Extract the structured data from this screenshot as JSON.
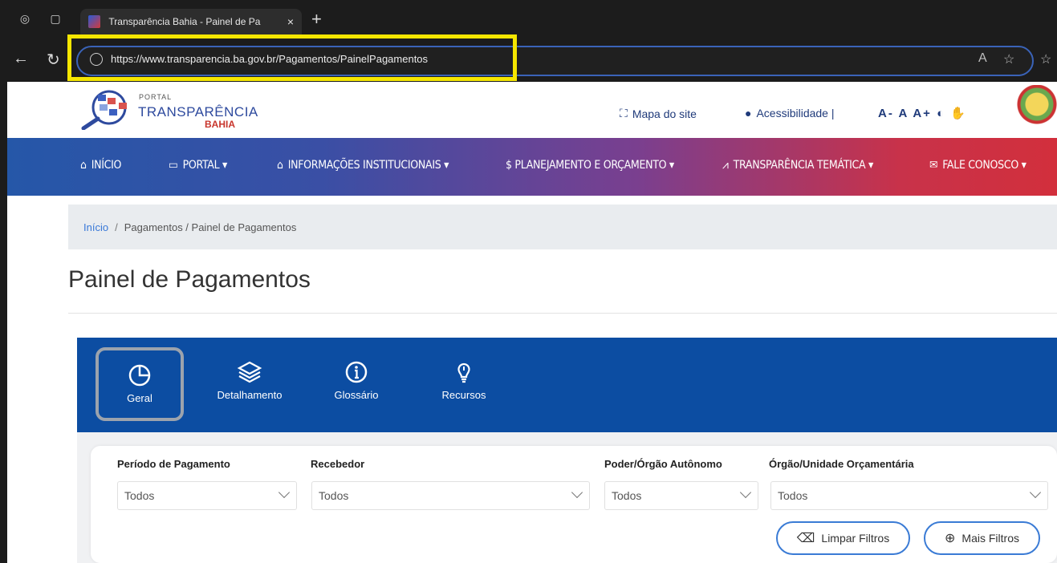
{
  "browser": {
    "tab_title": "Transparência Bahia - Painel de Pa",
    "url": "https://www.transparencia.ba.gov.br/Pagamentos/PainelPagamentos"
  },
  "header": {
    "logo_portal": "PORTAL",
    "logo_transparencia": "TRANSPARÊNCIA",
    "logo_bahia": "BAHIA",
    "sitemap_label": "Mapa do site",
    "accessibility_label": "Acessibilidade |",
    "font_controls": "A- A A+"
  },
  "nav": {
    "items": [
      {
        "label": "INÍCIO"
      },
      {
        "label": "PORTAL ▾"
      },
      {
        "label": "INFORMAÇÕES INSTITUCIONAIS ▾"
      },
      {
        "label": "$ PLANEJAMENTO E ORÇAMENTO ▾"
      },
      {
        "label": "TRANSPARÊNCIA TEMÁTICA ▾"
      },
      {
        "label": "FALE CONOSCO ▾"
      }
    ]
  },
  "breadcrumb": {
    "home": "Início",
    "trail": "Pagamentos / Painel de Pagamentos"
  },
  "page": {
    "title": "Painel de Pagamentos"
  },
  "panel": {
    "tabs": [
      {
        "label": "Geral",
        "icon": "pie-chart-icon",
        "active": true
      },
      {
        "label": "Detalhamento",
        "icon": "layers-icon"
      },
      {
        "label": "Glossário",
        "icon": "info-icon"
      },
      {
        "label": "Recursos",
        "icon": "lightbulb-icon"
      }
    ],
    "filters": [
      {
        "label": "Período de Pagamento",
        "value": "Todos"
      },
      {
        "label": "Recebedor",
        "value": "Todos"
      },
      {
        "label": "Poder/Órgão Autônomo",
        "value": "Todos"
      },
      {
        "label": "Órgão/Unidade Orçamentária",
        "value": "Todos"
      }
    ],
    "clear_filters": "Limpar Filtros",
    "more_filters": "Mais Filtros"
  },
  "colors": {
    "panel_blue": "#0c4da2",
    "highlight_yellow": "#f5e600",
    "navbar_start": "#2557a8",
    "navbar_end": "#d22f3c"
  }
}
